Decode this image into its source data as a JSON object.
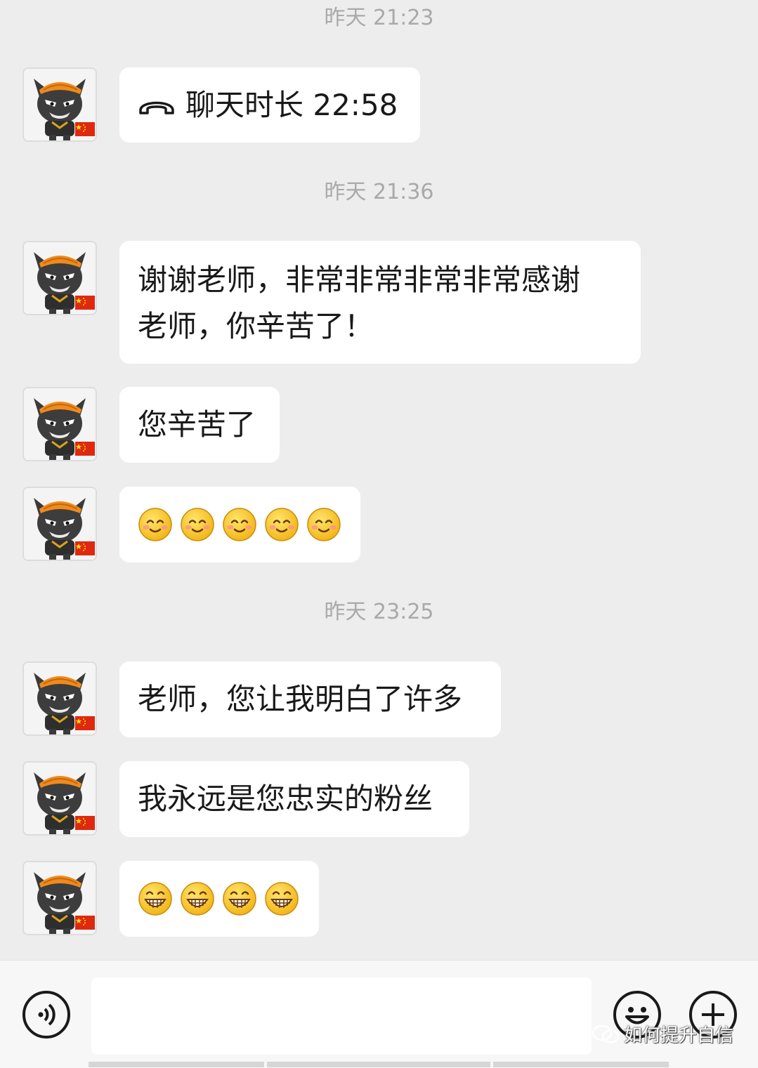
{
  "timestamps": [
    "昨天 21:23",
    "昨天 21:36",
    "昨天 23:25"
  ],
  "messages": {
    "call": {
      "icon": "phone-hangup-icon",
      "text": "聊天时长 22:58"
    },
    "m1": "谢谢老师，非常非常非常非常感谢\n老师，你辛苦了！",
    "m2": "您辛苦了",
    "m3_emoji": {
      "icon": "smile-emoji",
      "count": 5
    },
    "m4": "老师，您让我明白了许多",
    "m5": "我永远是您忠实的粉丝",
    "m6_emoji": {
      "icon": "grin-emoji",
      "count": 4
    }
  },
  "input_bar": {
    "voice_button": "voice-icon",
    "emoji_button": "emoji-face-icon",
    "more_button": "plus-icon"
  },
  "watermark": "如何提升自信",
  "colors": {
    "background": "#ededed",
    "bubble": "#ffffff",
    "timestamp": "#a9a9a9",
    "text": "#191919"
  }
}
